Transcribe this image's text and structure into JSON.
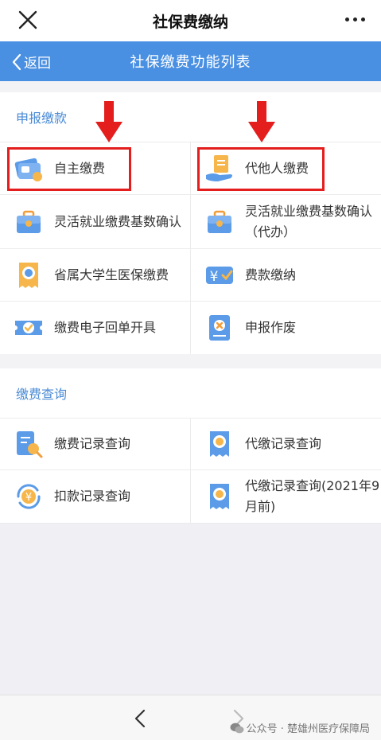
{
  "window": {
    "title": "社保费缴纳"
  },
  "header": {
    "back_label": "返回",
    "title": "社保缴费功能列表",
    "color": "#4a90e2"
  },
  "sections": [
    {
      "title": "申报缴款",
      "items": [
        {
          "label": "自主缴费",
          "icon": "card-icon",
          "highlighted": true
        },
        {
          "label": "代他人缴费",
          "icon": "hand-document-icon",
          "highlighted": true
        },
        {
          "label": "灵活就业缴费基数确认",
          "icon": "briefcase-icon"
        },
        {
          "label": "灵活就业缴费基数确认（代办）",
          "icon": "briefcase-icon"
        },
        {
          "label": "省属大学生医保缴费",
          "icon": "receipt-icon"
        },
        {
          "label": "费款缴纳",
          "icon": "yuan-payment-icon"
        },
        {
          "label": "缴费电子回单开具",
          "icon": "ticket-check-icon"
        },
        {
          "label": "申报作废",
          "icon": "document-cancel-icon"
        }
      ]
    },
    {
      "title": "缴费查询",
      "items": [
        {
          "label": "缴费记录查询",
          "icon": "document-search-icon"
        },
        {
          "label": "代缴记录查询",
          "icon": "receipt-search-icon"
        },
        {
          "label": "扣款记录查询",
          "icon": "yuan-refresh-icon"
        },
        {
          "label": "代缴记录查询(2021年9月前)",
          "icon": "receipt-search-icon"
        }
      ]
    }
  ],
  "watermark": "公众号 · 楚雄州医疗保障局",
  "accent_red": "#e41d1d"
}
